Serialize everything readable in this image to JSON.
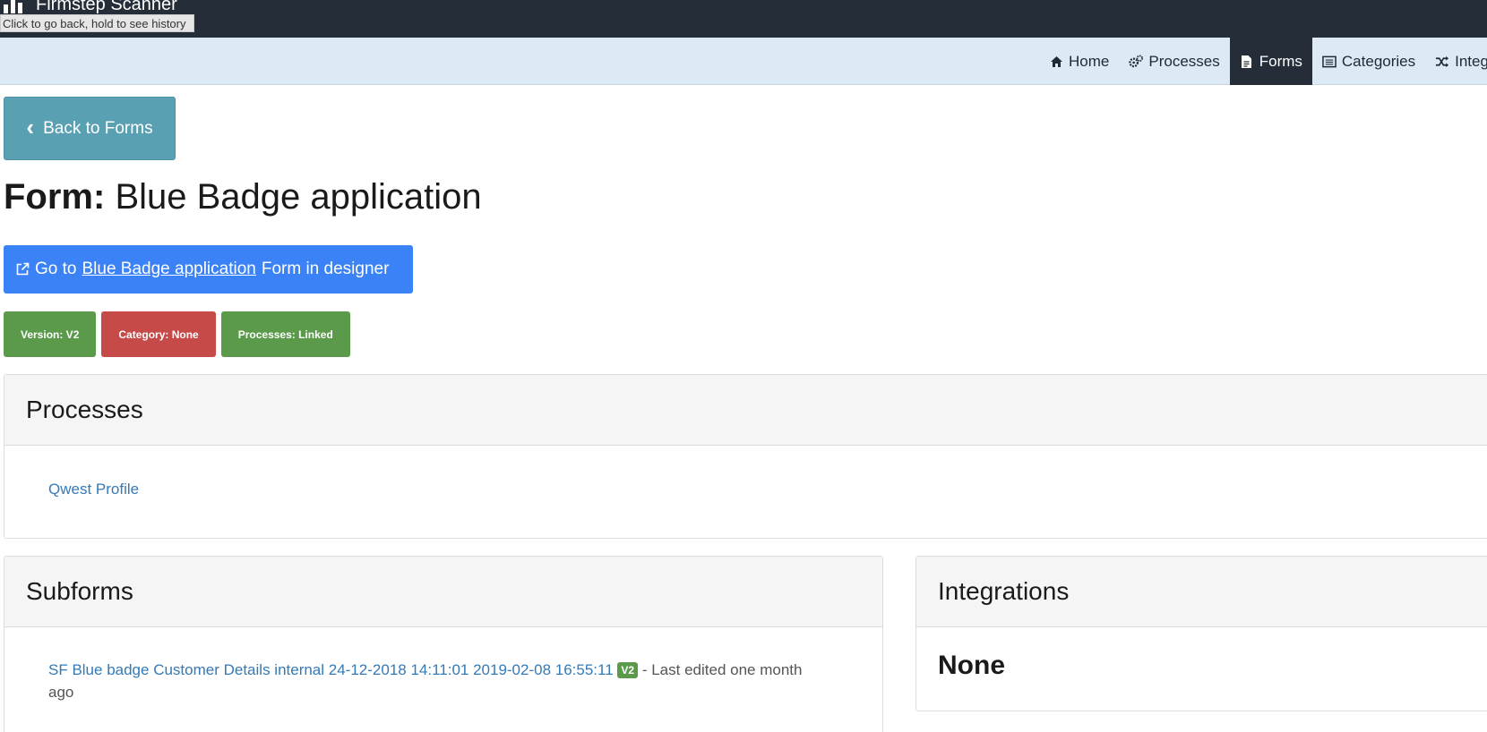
{
  "app": {
    "brand": "Firmstep Scanner",
    "tooltip": "Click to go back, hold to see history"
  },
  "nav": {
    "items": [
      {
        "label": "Home",
        "icon": "home-icon"
      },
      {
        "label": "Processes",
        "icon": "cogs-icon"
      },
      {
        "label": "Forms",
        "icon": "file-icon",
        "active": true
      },
      {
        "label": "Categories",
        "icon": "list-alt-icon"
      },
      {
        "label": "Integ",
        "icon": "shuffle-icon"
      }
    ]
  },
  "back_button": {
    "label": "Back to Forms"
  },
  "title": {
    "prefix": "Form:",
    "name": "Blue Badge application"
  },
  "designer_button": {
    "pre": "Go to",
    "link": "Blue Badge application",
    "post": "Form in designer"
  },
  "badges": [
    {
      "label": "Version: V2",
      "color": "#5a9a4a"
    },
    {
      "label": "Category: None",
      "color": "#c54a48"
    },
    {
      "label": "Processes: Linked",
      "color": "#5a9a4a"
    }
  ],
  "processes_panel": {
    "heading": "Processes",
    "items": [
      "Qwest Profile"
    ]
  },
  "subforms_panel": {
    "heading": "Subforms",
    "items": [
      {
        "link": "SF Blue badge Customer Details internal 24-12-2018 14:11:01 2019-02-08 16:55:11",
        "version": "V2",
        "suffix": " - Last edited one month ago"
      }
    ]
  },
  "integrations_panel": {
    "heading": "Integrations",
    "value": "None"
  },
  "colors": {
    "topbar": "#252d38",
    "navbar": "#dde9f5",
    "back_button": "#5aa0b3",
    "primary": "#3b82f6",
    "success": "#5a9a4a",
    "danger": "#c54a48",
    "link": "#337ab7"
  }
}
